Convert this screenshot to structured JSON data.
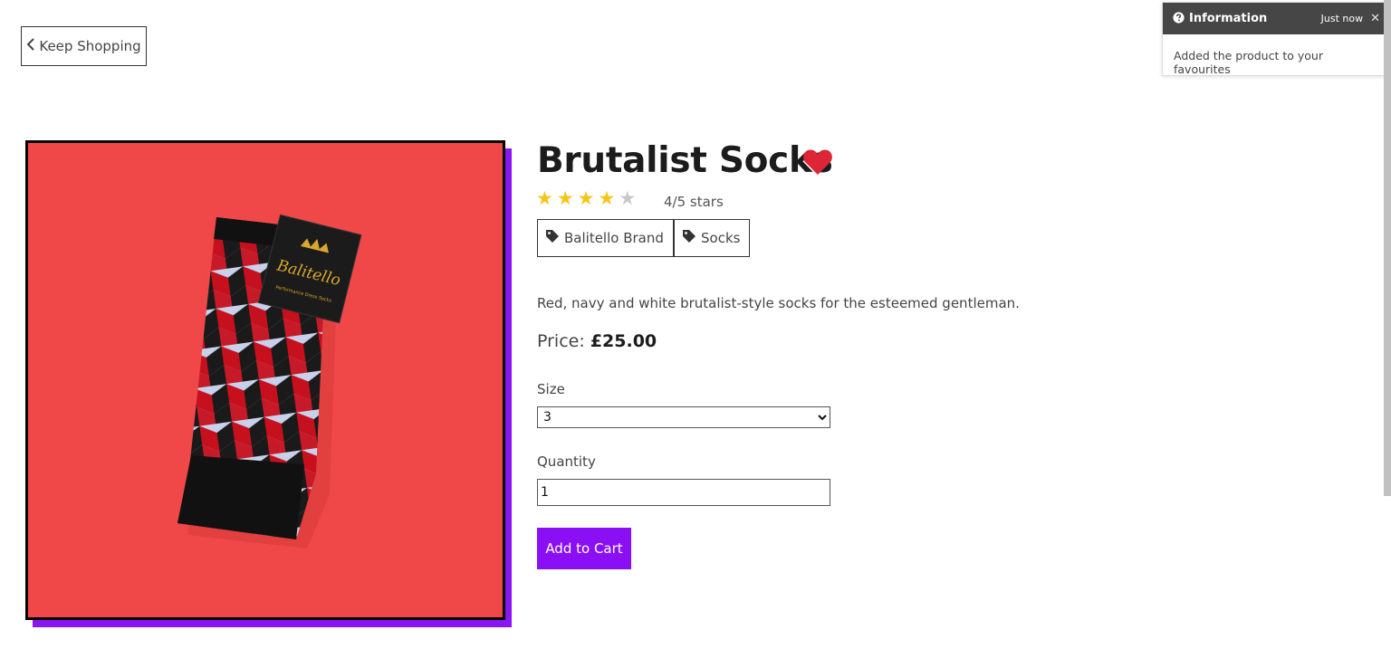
{
  "nav": {
    "back_label": "Keep Shopping",
    "back_icon": "chevron-left-icon"
  },
  "toast": {
    "title": "Information",
    "time": "Just now",
    "message": "Added the product to your favourites",
    "icon": "question-circle-icon",
    "close_icon": "close-icon"
  },
  "product": {
    "name": "Brutalist Socks",
    "favourite": true,
    "rating": 4,
    "rating_max": 5,
    "rating_text": "4/5 stars",
    "tags": [
      "Balitello Brand",
      "Socks"
    ],
    "description": "Red, navy and white brutalist-style socks for the esteemed gentleman.",
    "price_label": "Price:",
    "price": "£25.00",
    "size_label": "Size",
    "size_value": "3",
    "quantity_label": "Quantity",
    "quantity_value": "1",
    "add_to_cart": "Add to Cart",
    "image_brand_text": "Balitello"
  },
  "colors": {
    "accent": "#8a0ff5",
    "heart": "#dc2637",
    "star": "#f5c518",
    "image_background": "#f04848"
  }
}
